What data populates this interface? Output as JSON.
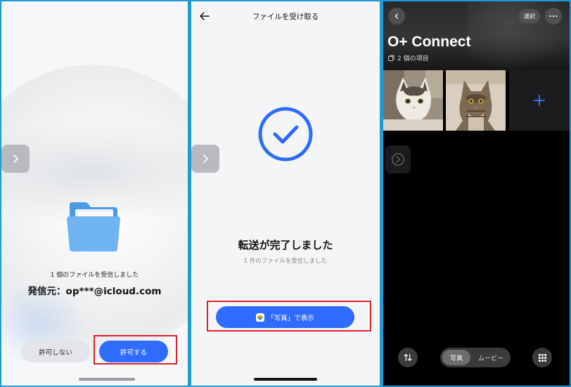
{
  "panel1": {
    "received_text": "1 個のファイルを受信しました",
    "sender_text": "発信元：op***@icloud.com",
    "deny_label": "許可しない",
    "allow_label": "許可する"
  },
  "panel2": {
    "title": "ファイルを受け取る",
    "main_text": "転送が完了しました",
    "sub_text": "1 件のファイルを受信しました",
    "show_button_label": "「写真」で表示"
  },
  "panel3": {
    "select_label": "選択",
    "album_title": "O+ Connect",
    "item_count": "2 個の項目",
    "seg_photos": "写真",
    "seg_movies": "ムービー"
  },
  "colors": {
    "accent_blue": "#2f6bff",
    "highlight_red": "#d9232e",
    "panel_border": "#1e9bd7"
  },
  "icons": [
    "chevron-right-icon",
    "folder-icon",
    "back-arrow-icon",
    "checkmark-circle-icon",
    "photos-app-icon",
    "chevron-left-icon",
    "more-icon",
    "photo-stack-icon",
    "plus-icon",
    "sort-icon",
    "grid-icon"
  ]
}
